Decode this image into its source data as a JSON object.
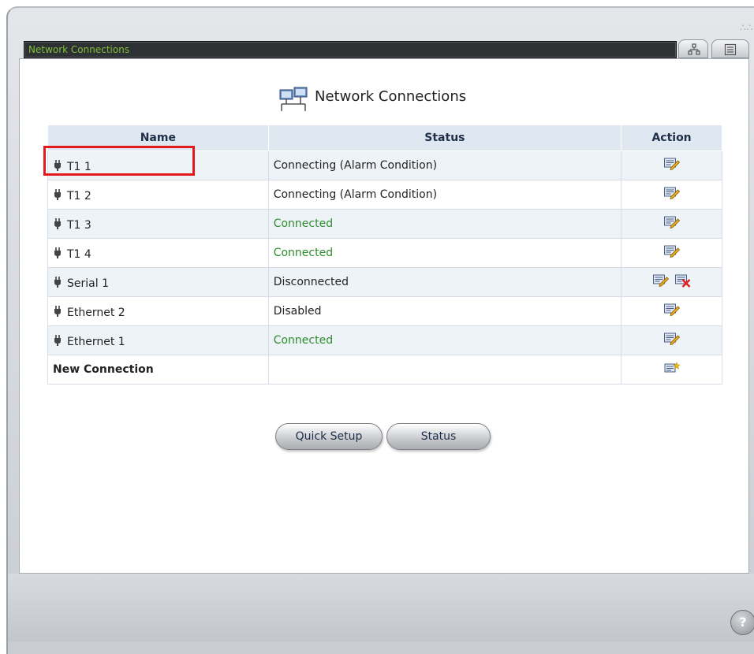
{
  "window": {
    "title": "Network Connections",
    "grip": "∴∴∴"
  },
  "page": {
    "heading": "Network Connections"
  },
  "table": {
    "headers": [
      "Name",
      "Status",
      "Action"
    ],
    "rows": [
      {
        "name": "T1 1",
        "status": "Connecting (Alarm Condition)",
        "status_color": "#222222",
        "actions": [
          "edit-icon"
        ]
      },
      {
        "name": "T1 2",
        "status": "Connecting (Alarm Condition)",
        "status_color": "#222222",
        "actions": [
          "edit-icon"
        ]
      },
      {
        "name": "T1 3",
        "status": "Connected",
        "status_color": "#2e8b2e",
        "actions": [
          "edit-icon"
        ]
      },
      {
        "name": "T1 4",
        "status": "Connected",
        "status_color": "#2e8b2e",
        "actions": [
          "edit-icon"
        ]
      },
      {
        "name": "Serial 1",
        "status": "Disconnected",
        "status_color": "#222222",
        "actions": [
          "edit-icon",
          "delete-icon"
        ]
      },
      {
        "name": "Ethernet 2",
        "status": "Disabled",
        "status_color": "#222222",
        "actions": [
          "edit-icon"
        ]
      },
      {
        "name": "Ethernet 1",
        "status": "Connected",
        "status_color": "#2e8b2e",
        "actions": [
          "edit-icon"
        ]
      }
    ],
    "new_connection": {
      "label": "New Connection",
      "action": "new-icon"
    }
  },
  "buttons": {
    "quick_setup": "Quick Setup",
    "status": "Status"
  },
  "help": "?"
}
